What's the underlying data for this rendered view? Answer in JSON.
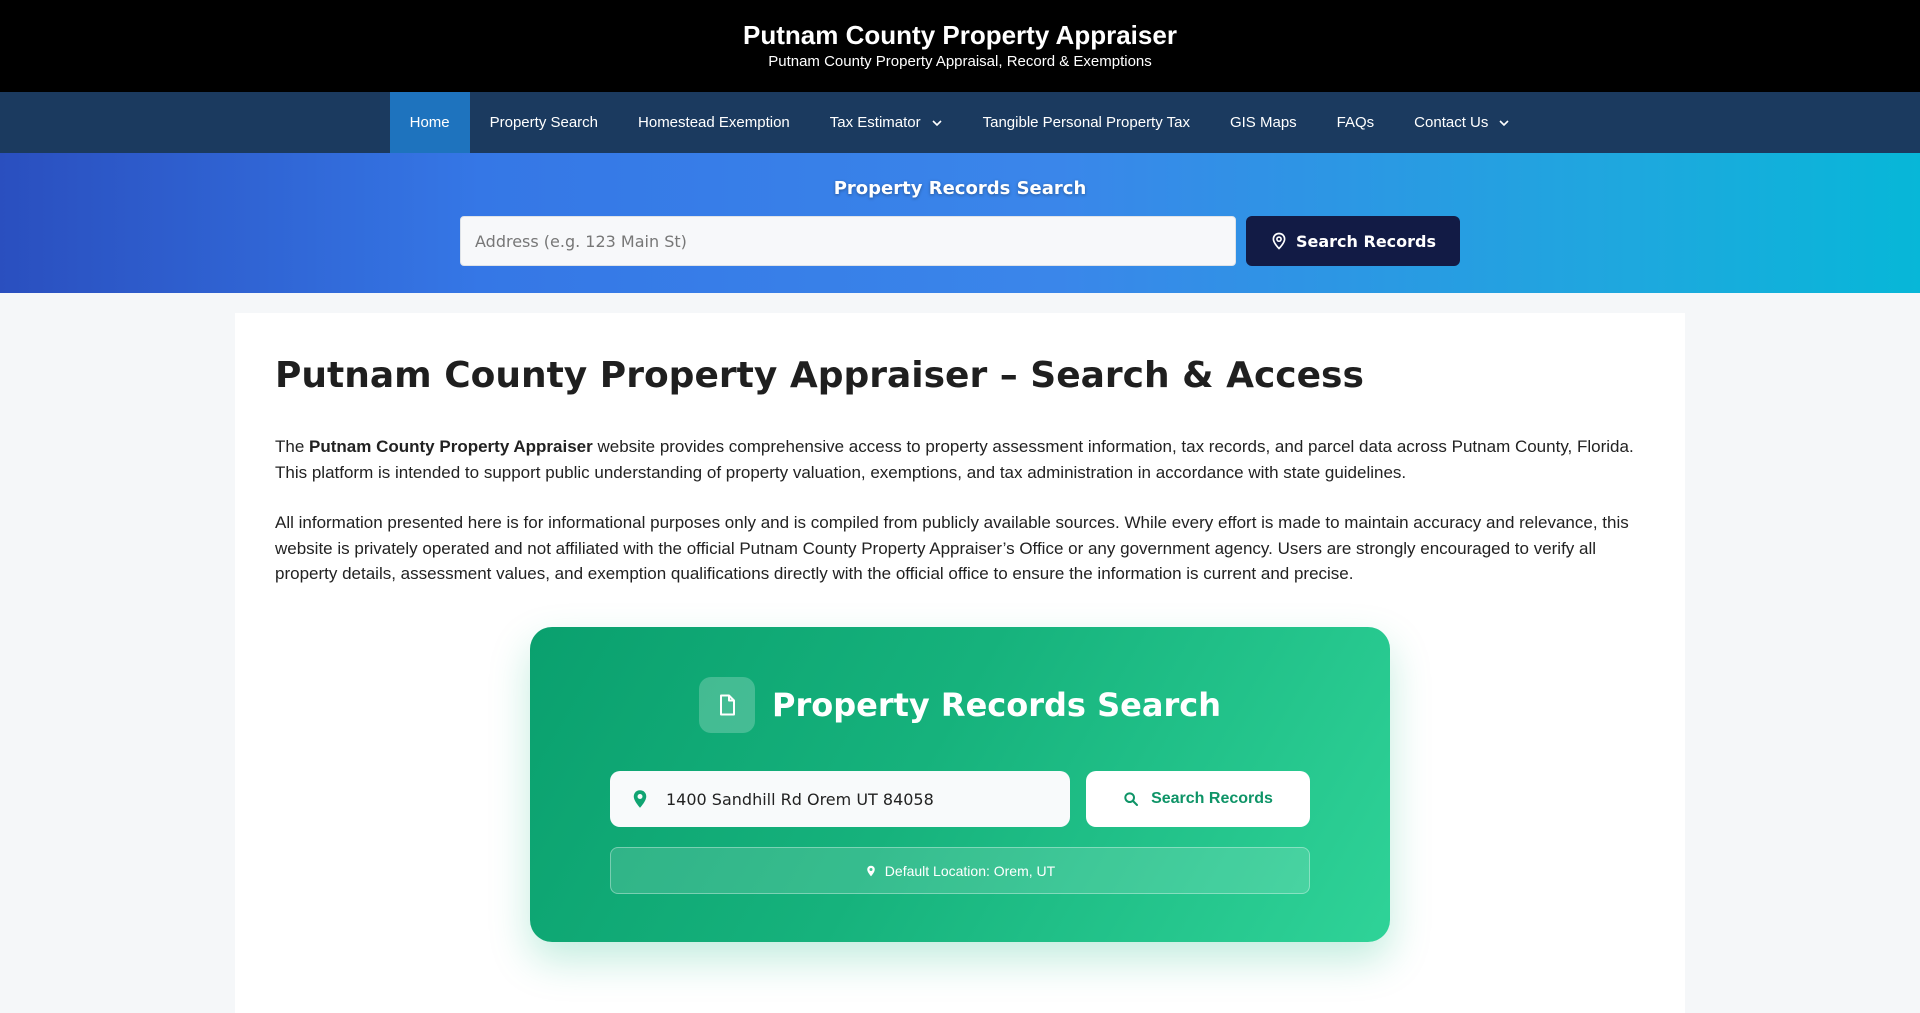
{
  "header": {
    "title": "Putnam County Property Appraiser",
    "tagline": "Putnam County Property Appraisal, Record & Exemptions"
  },
  "nav": {
    "items": [
      {
        "label": "Home",
        "active": true
      },
      {
        "label": "Property Search"
      },
      {
        "label": "Homestead Exemption"
      },
      {
        "label": "Tax Estimator",
        "dropdown": true
      },
      {
        "label": "Tangible Personal Property Tax"
      },
      {
        "label": "GIS Maps"
      },
      {
        "label": "FAQs"
      },
      {
        "label": "Contact Us",
        "dropdown": true
      }
    ]
  },
  "hero": {
    "title": "Property Records Search",
    "placeholder": "Address (e.g. 123 Main St)",
    "button_label": "Search Records"
  },
  "main": {
    "title": "Putnam County Property Appraiser – Search & Access",
    "intro_prefix": "The ",
    "intro_bold": "Putnam County Property Appraiser",
    "intro_rest": " website provides comprehensive access to property assessment information, tax records, and parcel data across Putnam County, Florida. This platform is intended to support public understanding of property valuation, exemptions, and tax administration in accordance with state guidelines.",
    "disclaimer": "All information presented here is for informational purposes only and is compiled from publicly available sources. While every effort is made to maintain accuracy and relevance, this website is privately operated and not affiliated with the official Putnam County Property Appraiser’s Office or any government agency. Users are strongly encouraged to verify all property details, assessment values, and exemption qualifications directly with the official office to ensure the information is current and precise."
  },
  "card": {
    "title": "Property Records Search",
    "input_value": "1400 Sandhill Rd Orem UT 84058",
    "button_label": "Search Records",
    "default_location": "Default Location: Orem, UT"
  },
  "colors": {
    "header_bg": "#000000",
    "nav_bg": "#1b3a5f",
    "nav_active": "#1e73be",
    "hero_button": "#121b45",
    "card_green": "#10b981"
  },
  "icons": {
    "hero_button": "map-pin-outline-icon",
    "card_header": "document-icon",
    "card_input": "map-pin-icon",
    "card_button": "search-icon",
    "card_note": "map-pin-icon",
    "nav_dropdown": "chevron-down-icon"
  }
}
